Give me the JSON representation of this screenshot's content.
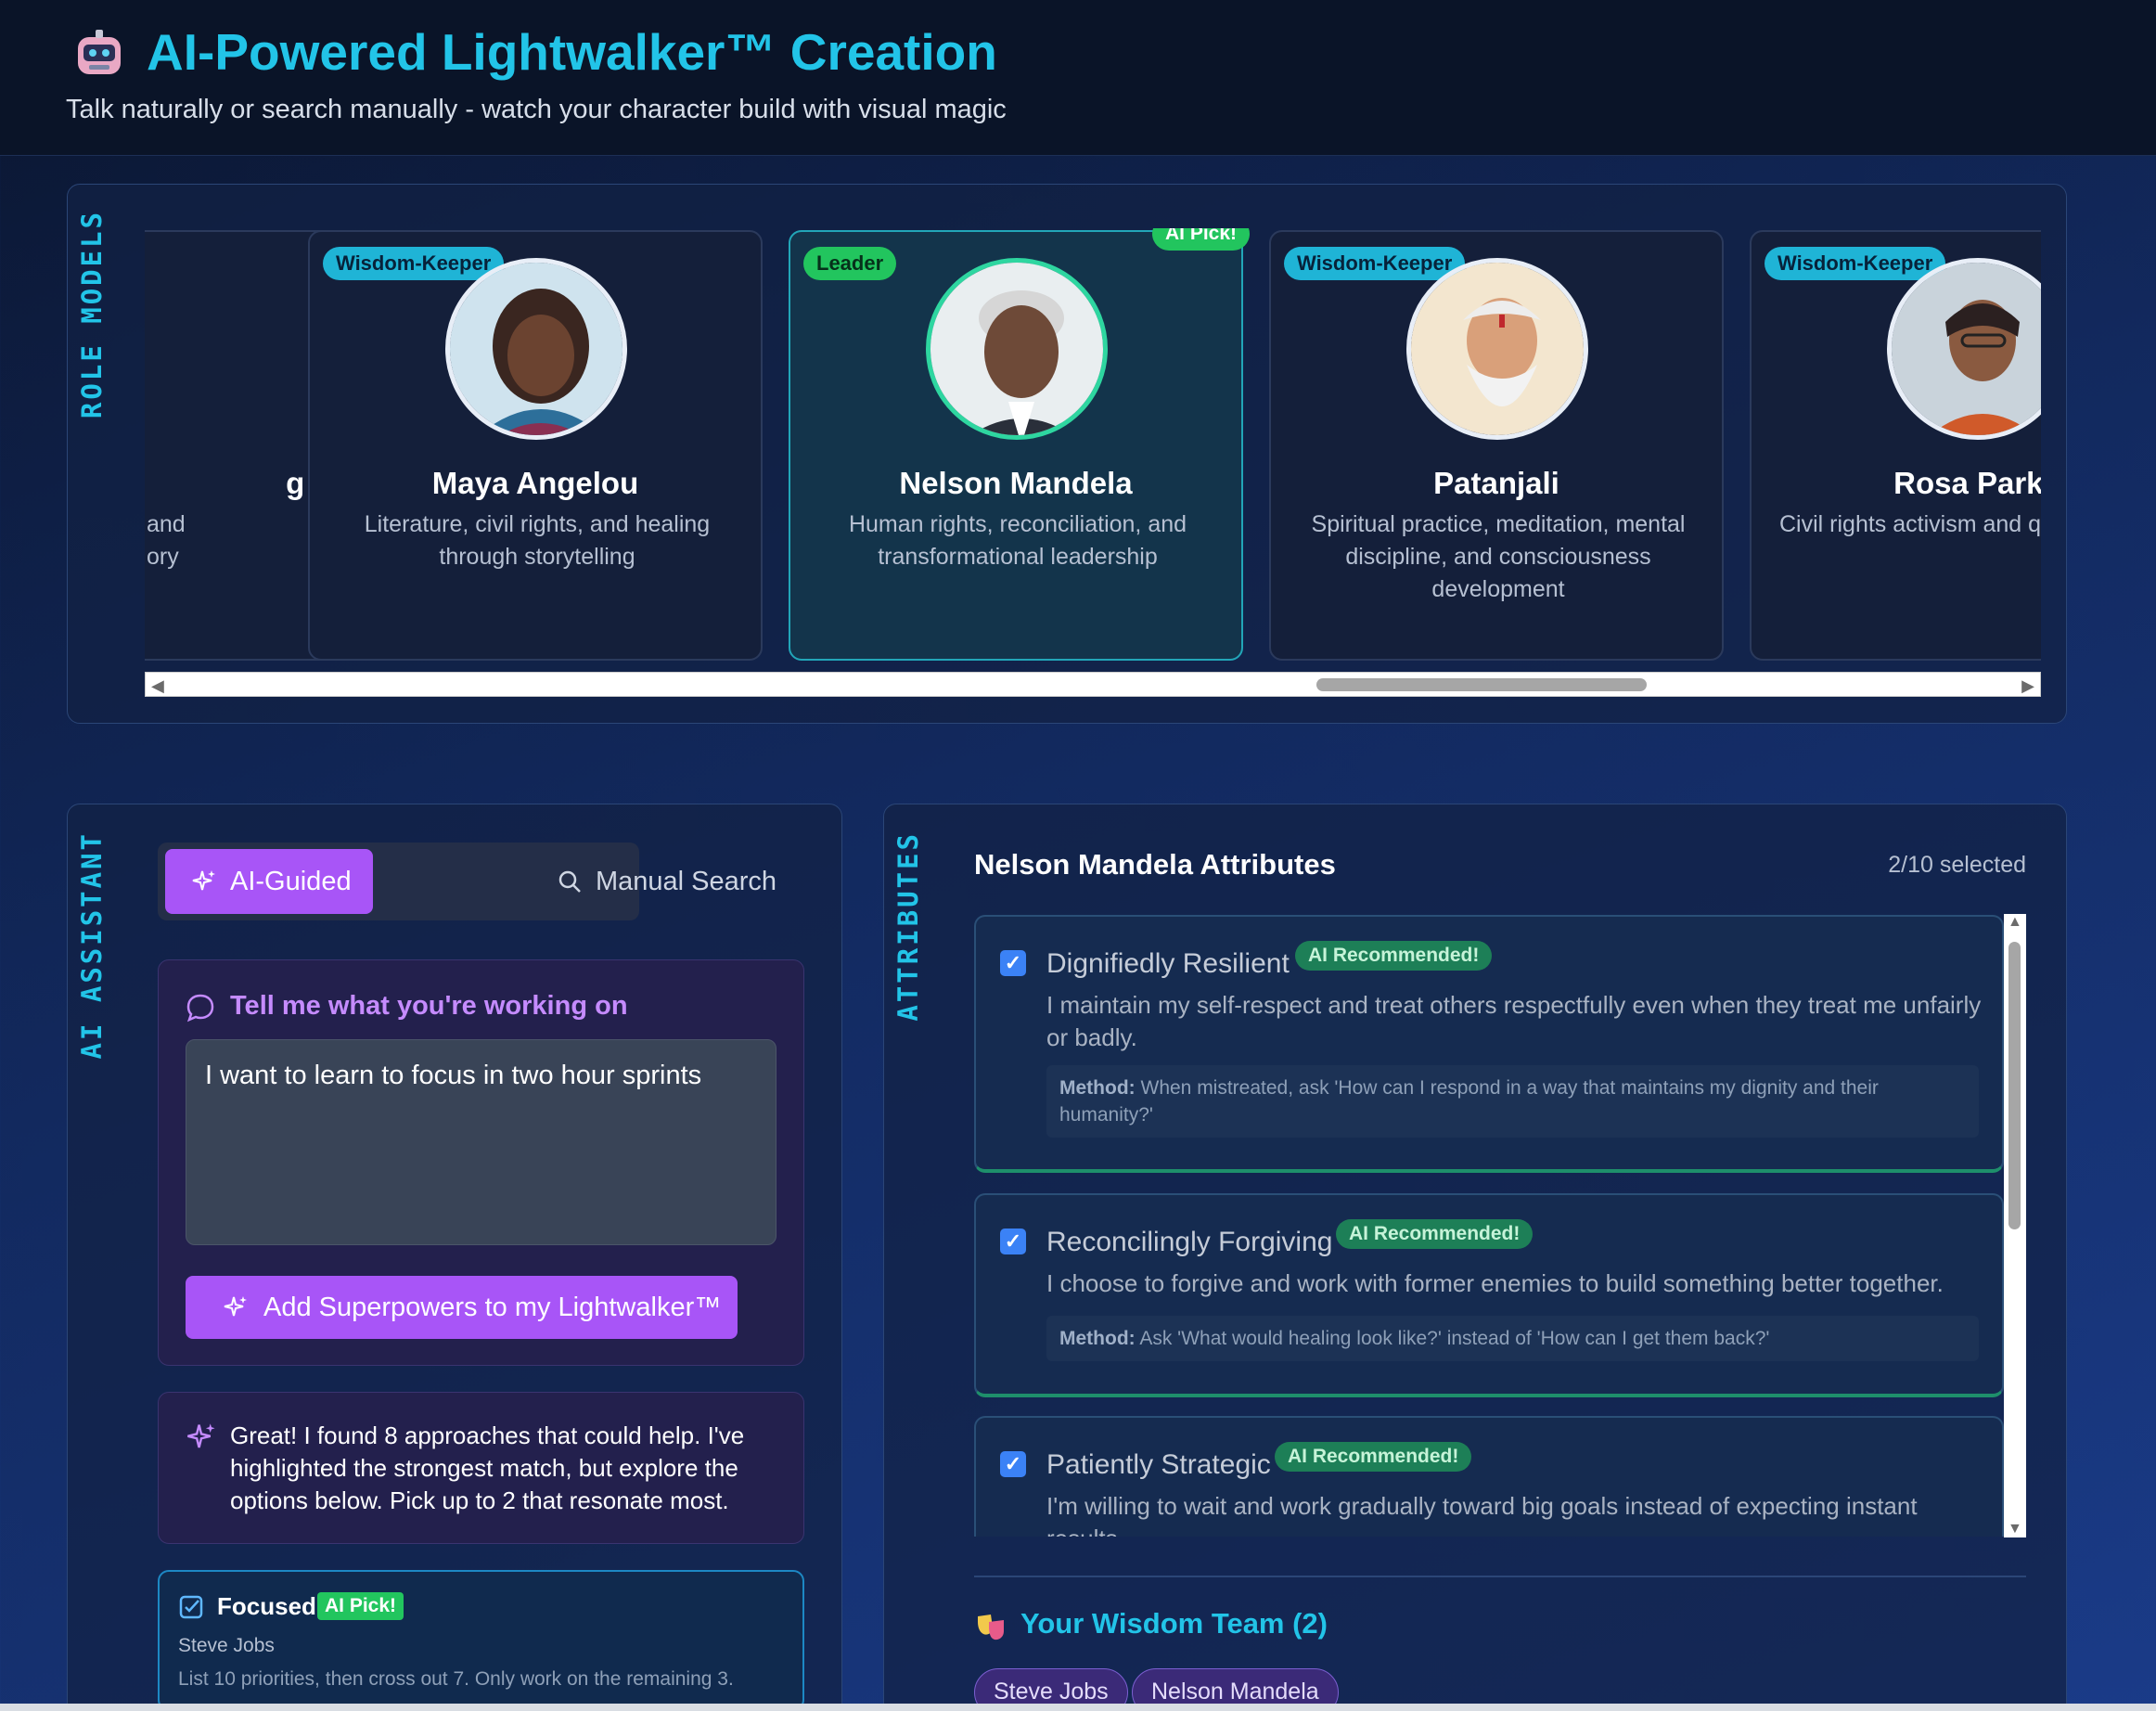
{
  "header": {
    "title": "AI-Powered Lightwalker™ Creation",
    "subtitle": "Talk naturally or search manually - watch your character build with visual magic"
  },
  "role_models": {
    "section_label": "ROLE MODELS",
    "cards": [
      {
        "name": "g Jr.",
        "desc": "and\nory",
        "badge": ""
      },
      {
        "name": "Maya Angelou",
        "desc": "Literature, civil rights, and healing through storytelling",
        "badge": "Wisdom-Keeper"
      },
      {
        "name": "Nelson Mandela",
        "desc": "Human rights, reconciliation, and transformational leadership",
        "badge": "Leader",
        "ai_pick": "AI Pick!"
      },
      {
        "name": "Patanjali",
        "desc": "Spiritual practice, meditation, mental discipline, and consciousness development",
        "badge": "Wisdom-Keeper"
      },
      {
        "name": "Rosa Parks",
        "desc": "Civil rights activism and qu",
        "badge": "Wisdom-Keeper"
      }
    ]
  },
  "assistant": {
    "section_label": "AI ASSISTANT",
    "tab_ai": "AI-Guided",
    "tab_manual": "Manual Search",
    "prompt_title": "Tell me what you're working on",
    "input_value": "I want to learn to focus in two hour sprints",
    "add_button": "Add Superpowers to my Lightwalker™",
    "message": "Great! I found 8 approaches that could help. I've highlighted the strongest match, but explore the options below. Pick up to 2 that resonate most.",
    "result": {
      "title": "Focused",
      "badge": "AI Pick!",
      "source": "Steve Jobs",
      "desc": "List 10 priorities, then cross out 7. Only work on the remaining 3."
    }
  },
  "attributes": {
    "section_label": "ATTRIBUTES",
    "heading": "Nelson Mandela Attributes",
    "count": "2/10 selected",
    "rec_label": "AI Recommended!",
    "method_label": "Method:",
    "items": [
      {
        "name": "Dignifiedly Resilient",
        "desc": "I maintain my self-respect and treat others respectfully even when they treat me unfairly or badly.",
        "method": "When mistreated, ask 'How can I respond in a way that maintains my dignity and their humanity?'"
      },
      {
        "name": "Reconcilingly Forgiving",
        "desc": "I choose to forgive and work with former enemies to build something better together.",
        "method": "Ask 'What would healing look like?' instead of 'How can I get them back?'"
      },
      {
        "name": "Patiently Strategic",
        "desc": "I'm willing to wait and work gradually toward big goals instead of expecting instant results.",
        "method": ""
      }
    ],
    "team_title": "Your Wisdom Team (2)",
    "team": [
      "Steve Jobs",
      "Nelson Mandela"
    ]
  },
  "colors": {
    "accent_cyan": "#22c4e8",
    "accent_purple": "#a855f7",
    "green": "#22c55e"
  }
}
